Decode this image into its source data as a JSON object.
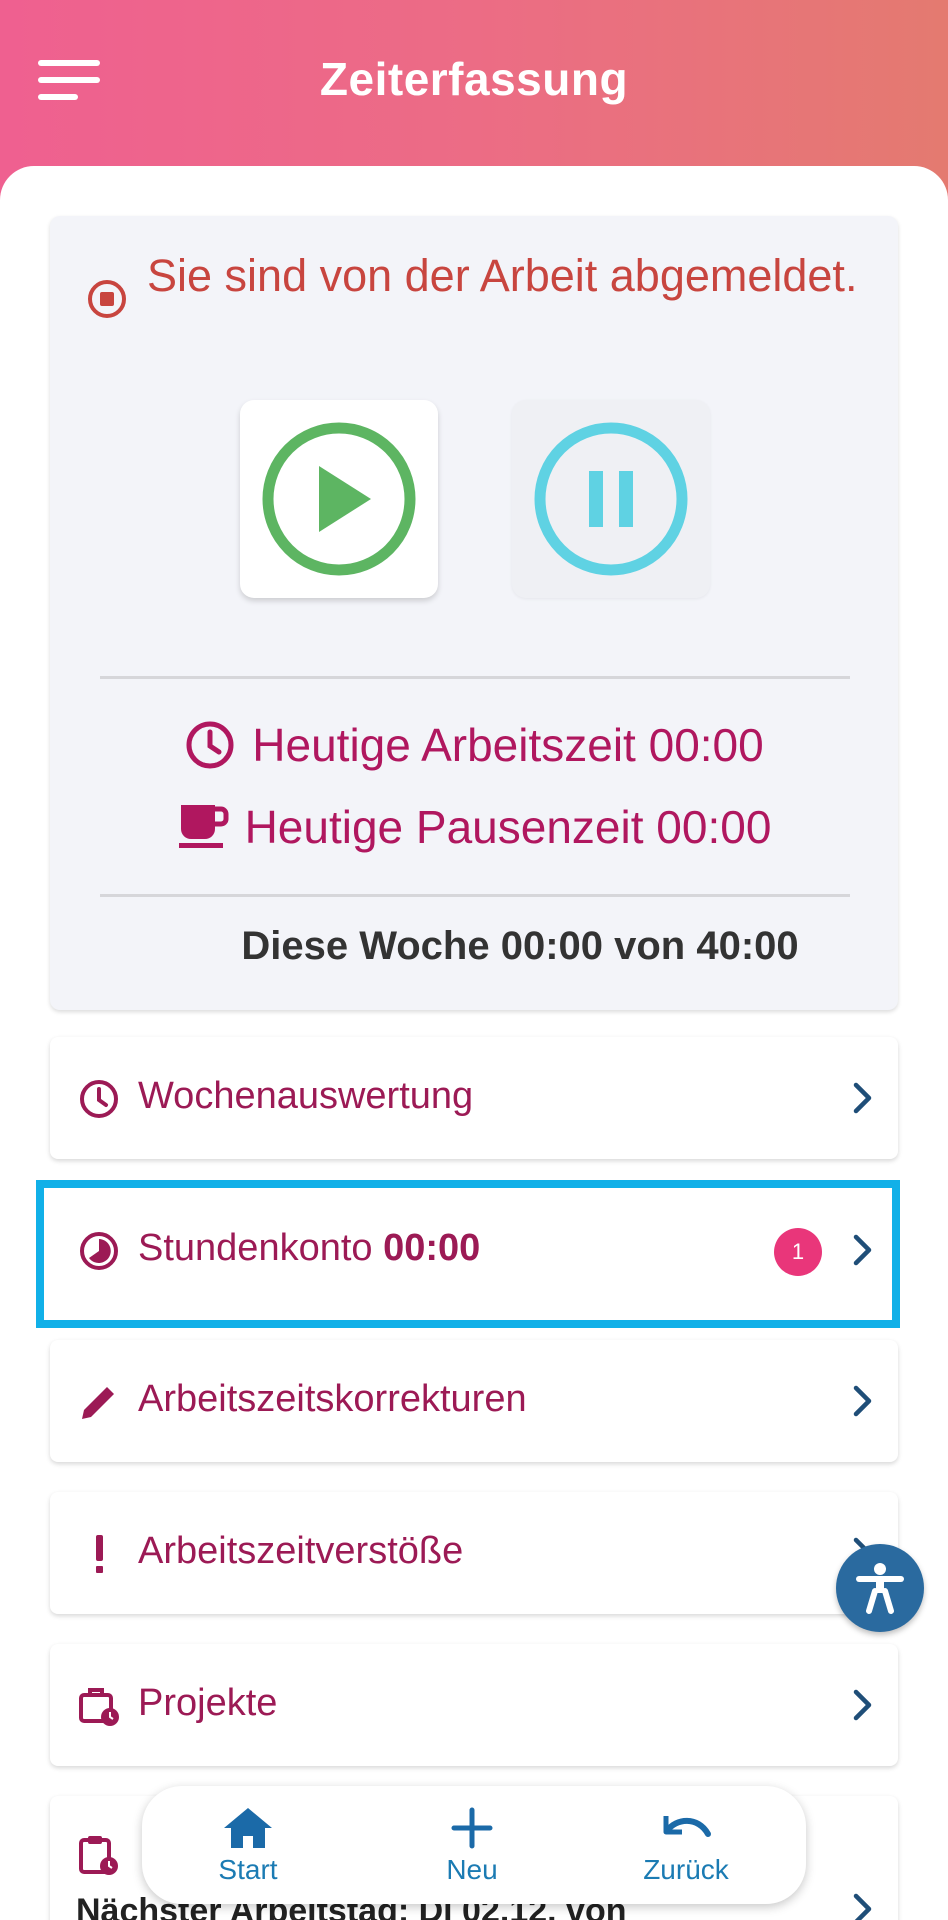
{
  "header": {
    "title": "Zeiterfassung"
  },
  "status": {
    "message": "Sie sind von der Arbeit abgemeldet.",
    "work_time_label": "Heutige Arbeitszeit 00:00",
    "pause_time_label": "Heutige Pausenzeit 00:00",
    "week_summary": "Diese Woche 00:00 von 40:00"
  },
  "menu": {
    "weekly": {
      "label": "Wochenauswertung",
      "icon": "clock-icon"
    },
    "account": {
      "label": "Stundenkonto ",
      "value": "00:00",
      "badge": "1",
      "icon": "pie-timer-icon"
    },
    "corrections": {
      "label": "Arbeitszeitskorrekturen",
      "icon": "pencil-icon"
    },
    "violations": {
      "label": "Arbeitszeitverstöße",
      "icon": "exclamation-icon"
    },
    "projects": {
      "label": "Projekte",
      "icon": "briefcase-clock-icon"
    },
    "next_workday": "Nächster Arbeitstag: Di 02.12. von"
  },
  "nav": {
    "start": "Start",
    "new": "Neu",
    "back": "Zurück"
  },
  "colors": {
    "header_start": "#ef6090",
    "header_end": "#e47a70",
    "accent_magenta": "#b0175f",
    "play_green": "#5db562",
    "pause_cyan": "#5fd2e3",
    "highlight": "#11b0e8",
    "nav_blue": "#1b7bb3"
  }
}
